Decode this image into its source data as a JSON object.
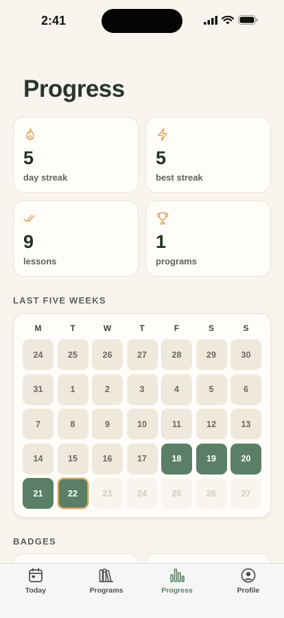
{
  "status_bar": {
    "time": "2:41"
  },
  "page": {
    "title": "Progress"
  },
  "stats": [
    {
      "icon": "flame-icon",
      "value": "5",
      "label": "day streak"
    },
    {
      "icon": "lightning-icon",
      "value": "5",
      "label": "best streak"
    },
    {
      "icon": "double-check-icon",
      "value": "9",
      "label": "lessons"
    },
    {
      "icon": "trophy-icon",
      "value": "1",
      "label": "programs"
    }
  ],
  "calendar": {
    "section_label": "LAST FIVE WEEKS",
    "weekdays": [
      "M",
      "T",
      "W",
      "T",
      "F",
      "S",
      "S"
    ],
    "days": [
      {
        "label": "24",
        "state": "past"
      },
      {
        "label": "25",
        "state": "past"
      },
      {
        "label": "26",
        "state": "past"
      },
      {
        "label": "27",
        "state": "past"
      },
      {
        "label": "28",
        "state": "past"
      },
      {
        "label": "29",
        "state": "past"
      },
      {
        "label": "30",
        "state": "past"
      },
      {
        "label": "31",
        "state": "past"
      },
      {
        "label": "1",
        "state": "past"
      },
      {
        "label": "2",
        "state": "past"
      },
      {
        "label": "3",
        "state": "past"
      },
      {
        "label": "4",
        "state": "past"
      },
      {
        "label": "5",
        "state": "past"
      },
      {
        "label": "6",
        "state": "past"
      },
      {
        "label": "7",
        "state": "past"
      },
      {
        "label": "8",
        "state": "past"
      },
      {
        "label": "9",
        "state": "past"
      },
      {
        "label": "10",
        "state": "past"
      },
      {
        "label": "11",
        "state": "past"
      },
      {
        "label": "12",
        "state": "past"
      },
      {
        "label": "13",
        "state": "past"
      },
      {
        "label": "14",
        "state": "past"
      },
      {
        "label": "15",
        "state": "past"
      },
      {
        "label": "16",
        "state": "past"
      },
      {
        "label": "17",
        "state": "past"
      },
      {
        "label": "18",
        "state": "done"
      },
      {
        "label": "19",
        "state": "done"
      },
      {
        "label": "20",
        "state": "done"
      },
      {
        "label": "21",
        "state": "done"
      },
      {
        "label": "22",
        "state": "today"
      },
      {
        "label": "23",
        "state": "future"
      },
      {
        "label": "24",
        "state": "future"
      },
      {
        "label": "25",
        "state": "future"
      },
      {
        "label": "26",
        "state": "future"
      },
      {
        "label": "27",
        "state": "future"
      }
    ]
  },
  "badges": {
    "section_label": "BADGES"
  },
  "tab_bar": {
    "tabs": [
      {
        "label": "Today",
        "icon": "calendar-icon",
        "active": false
      },
      {
        "label": "Programs",
        "icon": "books-icon",
        "active": false
      },
      {
        "label": "Progress",
        "icon": "bar-chart-icon",
        "active": true
      },
      {
        "label": "Profile",
        "icon": "user-circle-icon",
        "active": false
      }
    ]
  },
  "colors": {
    "accent_green": "#5a7f66",
    "icon_orange": "#e0a45e",
    "background": "#f9f5ee"
  }
}
